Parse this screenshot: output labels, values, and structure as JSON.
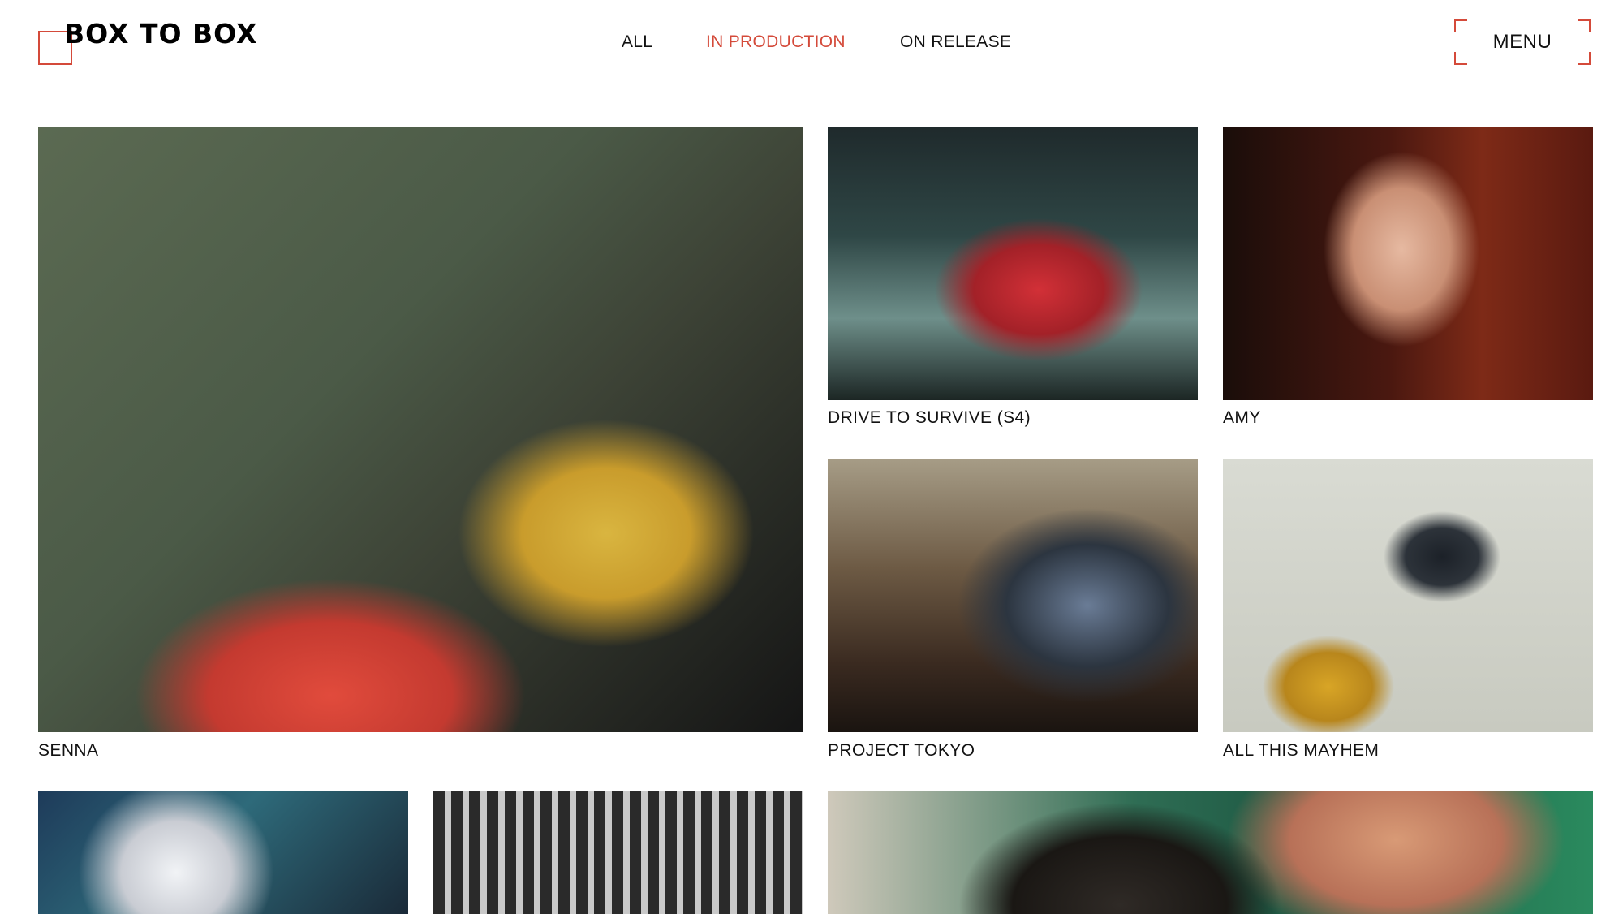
{
  "brand": {
    "name": "BOX TO BOX"
  },
  "nav": {
    "items": [
      {
        "label": "ALL"
      },
      {
        "label": "IN PRODUCTION"
      },
      {
        "label": "ON RELEASE"
      }
    ],
    "active_index": 1
  },
  "menu": {
    "label": "MENU"
  },
  "projects": [
    {
      "title": "SENNA"
    },
    {
      "title": "DRIVE TO SURVIVE (S4)"
    },
    {
      "title": "AMY"
    },
    {
      "title": "PROJECT TOKYO"
    },
    {
      "title": "ALL THIS MAYHEM"
    }
  ],
  "colors": {
    "accent": "#d44a3a",
    "text": "#111111",
    "background": "#ffffff"
  }
}
